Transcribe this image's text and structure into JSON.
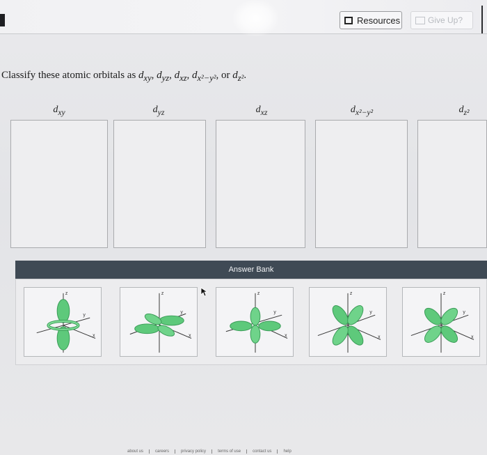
{
  "header": {
    "resources_label": "Resources",
    "give_up_label": "Give Up?"
  },
  "question": {
    "prompt_start": "Classify these atomic orbitals as ",
    "prompt_end": "."
  },
  "targets": [
    {
      "main": "d",
      "sub": "xy",
      "sup": ""
    },
    {
      "main": "d",
      "sub": "yz",
      "sup": ""
    },
    {
      "main": "d",
      "sub": "xz",
      "sup": ""
    },
    {
      "main": "d",
      "sub": "x²−y²",
      "sup": ""
    },
    {
      "main": "d",
      "sub": "z²",
      "sup": ""
    }
  ],
  "answer_bank": {
    "title": "Answer Bank",
    "axis_labels": {
      "z": "z",
      "y": "y",
      "x": "x"
    }
  },
  "footer": {
    "links": [
      "about us",
      "careers",
      "privacy policy",
      "terms of use",
      "contact us",
      "help"
    ]
  },
  "colors": {
    "orbital_fill": "#5ec97b",
    "orbital_stroke": "#3a9b57",
    "bank_header": "#3f4a55"
  }
}
